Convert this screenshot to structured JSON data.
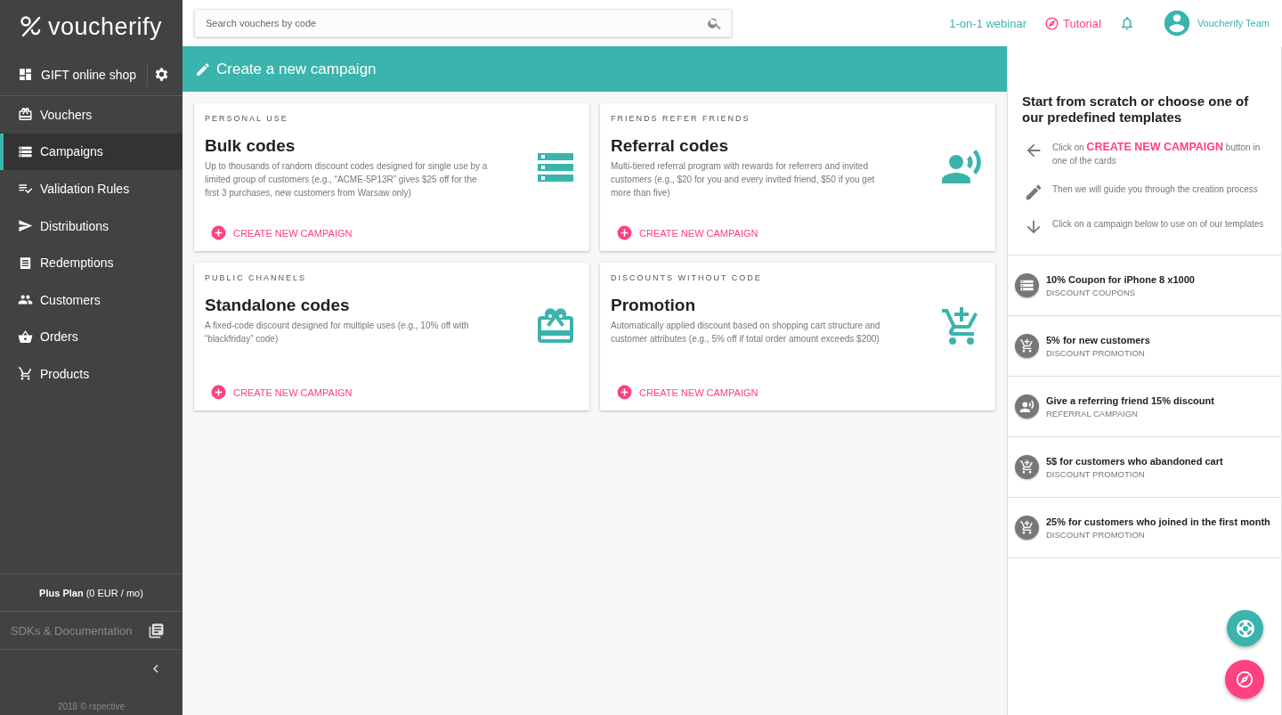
{
  "sidebar": {
    "logo": "voucherify",
    "shop": {
      "label": "GIFT online shop"
    },
    "items": [
      {
        "label": "Vouchers",
        "selected": false
      },
      {
        "label": "Campaigns",
        "selected": true
      },
      {
        "label": "Validation Rules",
        "selected": false
      },
      {
        "label": "Distributions",
        "selected": false
      },
      {
        "label": "Redemptions",
        "selected": false
      },
      {
        "label": "Customers",
        "selected": false
      },
      {
        "label": "Orders",
        "selected": false
      },
      {
        "label": "Products",
        "selected": false
      }
    ],
    "plan": "**Plus Plan** (0 EUR / mo)",
    "docs": "SDKs & Documentation",
    "footer": "2018 © rspective"
  },
  "topbar": {
    "search": {
      "placeholder": "Search vouchers by code"
    },
    "webinar": "1-on-1 webinar",
    "tutorial": "Tutorial",
    "user": "Voucherify Team"
  },
  "header": {
    "title": "Create a new campaign"
  },
  "cards": [
    {
      "kind": "bulk",
      "category": "PERSONAL USE",
      "title": "Bulk codes",
      "description": "Up to thousands of random discount codes designed for single use by a limited group of customers (e.g., “ACME-5P13R” gives $25 off for the first 3 purchases, new customers from Warsaw only)",
      "action": "CREATE NEW CAMPAIGN"
    },
    {
      "kind": "referral",
      "category": "FRIENDS REFER FRIENDS",
      "title": "Referral codes",
      "description": "Multi-tiered referral program with rewards for referrers and invited customers (e.g., $20 for you and every invited friend, $50 if you get more than five)",
      "action": "CREATE NEW CAMPAIGN"
    },
    {
      "kind": "standalone",
      "category": "PUBLIC CHANNELS",
      "title": "Standalone codes",
      "description": "A fixed-code discount designed for multiple uses (e.g., 10% off with “blackfriday” code)",
      "action": "CREATE NEW CAMPAIGN"
    },
    {
      "kind": "promotion",
      "category": "DISCOUNTS WITHOUT CODE",
      "title": "Promotion",
      "description": "Automatically applied discount based on shopping cart structure and customer attributes (e.g., 5% off if total order amount exceeds $200)",
      "action": "CREATE NEW CAMPAIGN"
    }
  ],
  "templates_panel": {
    "title": "Start from scratch or choose one of our predefined templates",
    "steps": [
      {
        "kind": "left",
        "text": "Click on **CREATE NEW CAMPAIGN** button in one of the cards"
      },
      {
        "kind": "edit",
        "text": "Then we will guide you through the creation process"
      },
      {
        "kind": "down",
        "text": "Click on a campaign below to use on of our templates"
      }
    ],
    "templates": [
      {
        "kind": "coupons",
        "name": "10% Coupon for iPhone 8 x1000",
        "type": "DISCOUNT COUPONS"
      },
      {
        "kind": "promotion",
        "name": "5% for new customers",
        "type": "DISCOUNT PROMOTION"
      },
      {
        "kind": "referral",
        "name": "Give a referring friend 15% discount",
        "type": "REFERRAL CAMPAIGN"
      },
      {
        "kind": "promotion",
        "name": "5$ for customers who abandoned cart",
        "type": "DISCOUNT PROMOTION"
      },
      {
        "kind": "promotion",
        "name": "25% for customers who joined in the first month",
        "type": "DISCOUNT PROMOTION"
      }
    ]
  }
}
